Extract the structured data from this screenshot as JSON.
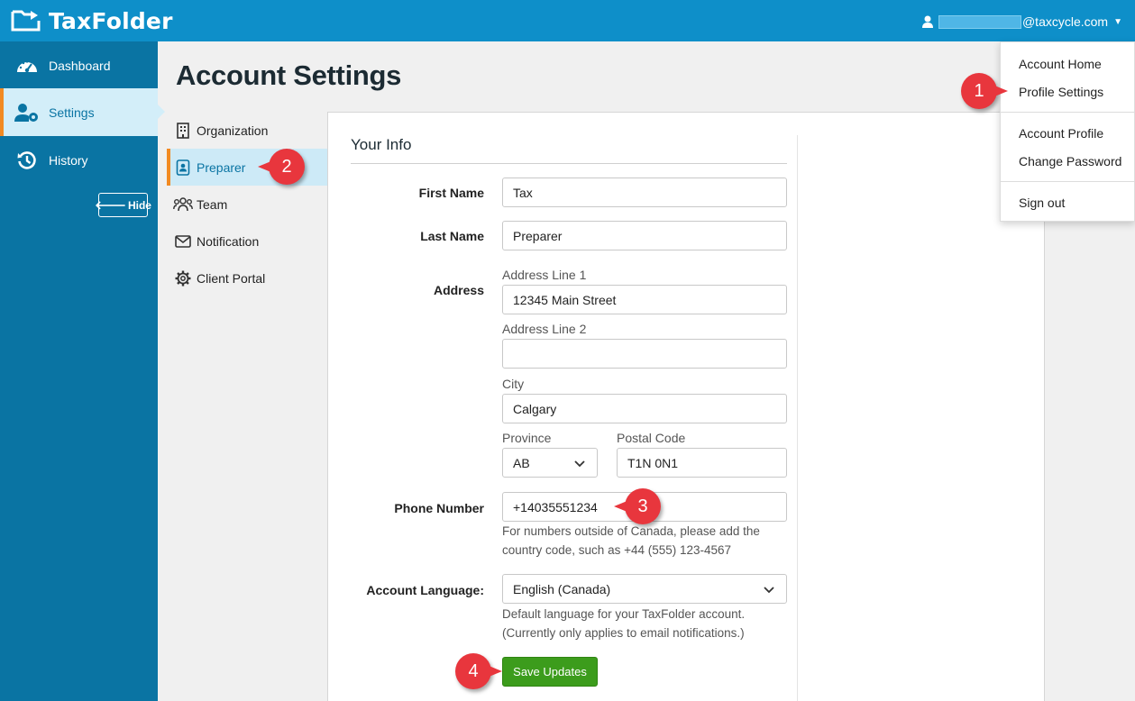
{
  "app": {
    "name": "TaxFolder"
  },
  "user_menu": {
    "email_suffix": "@taxcycle.com"
  },
  "sidebar": {
    "items": [
      {
        "label": "Dashboard",
        "icon": "dashboard-gauge-icon"
      },
      {
        "label": "Settings",
        "icon": "user-gear-icon",
        "active": true
      },
      {
        "label": "History",
        "icon": "history-icon"
      }
    ],
    "hide_label": "Hide"
  },
  "page": {
    "title": "Account Settings"
  },
  "subnav": {
    "items": [
      {
        "label": "Organization",
        "icon": "building-icon"
      },
      {
        "label": "Preparer",
        "icon": "contact-card-icon",
        "active": true
      },
      {
        "label": "Team",
        "icon": "users-icon"
      },
      {
        "label": "Notification",
        "icon": "envelope-icon"
      },
      {
        "label": "Client Portal",
        "icon": "gear-icon"
      }
    ]
  },
  "form": {
    "section_title": "Your Info",
    "first_name": {
      "label": "First Name",
      "value": "Tax"
    },
    "last_name": {
      "label": "Last Name",
      "value": "Preparer"
    },
    "address": {
      "label": "Address",
      "line1_label": "Address Line 1",
      "line1_value": "12345 Main Street",
      "line2_label": "Address Line 2",
      "line2_value": "",
      "city_label": "City",
      "city_value": "Calgary",
      "province_label": "Province",
      "province_value": "AB",
      "postal_label": "Postal Code",
      "postal_value": "T1N 0N1"
    },
    "phone": {
      "label": "Phone Number",
      "value": "+14035551234",
      "help_line1": "For numbers outside of Canada, please add the",
      "help_line2": "country code, such as +44 (555) 123-4567"
    },
    "language": {
      "label": "Account Language:",
      "value": "English (Canada)",
      "help_line1": "Default language for your TaxFolder account.",
      "help_line2": "(Currently only applies to email notifications.)"
    },
    "save_label": "Save Updates"
  },
  "dropdown": {
    "items": [
      "Account Home",
      "Profile Settings",
      "Account Profile",
      "Change Password",
      "Sign out"
    ]
  },
  "callouts": [
    "1",
    "2",
    "3",
    "4"
  ],
  "colors": {
    "topbar": "#0e8fc9",
    "sidebar": "#0a74a3",
    "active_accent": "#f28a22",
    "save_button": "#3c9c1c",
    "callout": "#e8363d"
  }
}
